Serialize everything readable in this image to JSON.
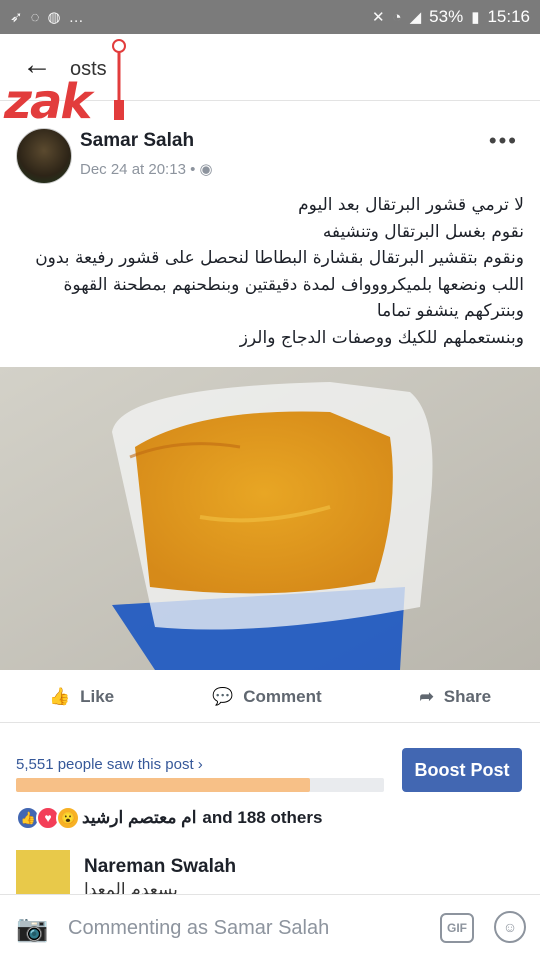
{
  "status": {
    "battery": "53%",
    "time": "15:16",
    "icons": [
      "notification-icon",
      "whatsapp-icon",
      "messenger-icon",
      "more-icon",
      "mute-icon",
      "wifi-icon",
      "signal-icon",
      "battery-icon"
    ]
  },
  "nav": {
    "back_icon": "back-arrow-icon",
    "title": "osts",
    "logo_text": "zak"
  },
  "post": {
    "author": "Samar Salah",
    "time": "Dec 24 at 20:13",
    "privacy_icon": "globe-icon",
    "text_lines": [
      "لا ترمي قشور البرتقال بعد اليوم",
      "نقوم  بغسل البرتقال وتنشيفه",
      "ونقوم بتقشير البرتقال بقشارة البطاطا لنحصل على قشور رفيعة بدون",
      "اللب ونضعها بلميكرووواف لمدة دقيقتين وبنطحنهم بمطحنة القهوة",
      "وبنتركهم ينشفو تماما",
      "وبنستعملهم للكيك ووصفات الدجاج والرز"
    ],
    "photo_desc": "photo"
  },
  "actions": {
    "like": "Like",
    "comment": "Comment",
    "share": "Share"
  },
  "reach": {
    "text": "5,551 people saw this post",
    "progress": 0.8,
    "boost": "Boost Post"
  },
  "reactions": {
    "names": "ام معتصم ارشيد",
    "others": "and 188 others"
  },
  "comment": {
    "author": "Nareman Swalah",
    "snippet": "بسعدم المعدا"
  },
  "composer": {
    "placeholder": "Commenting as Samar Salah",
    "gif": "GIF"
  },
  "colors": {
    "accent": "#4267b2",
    "link": "#365899",
    "progress": "#f7c087"
  }
}
